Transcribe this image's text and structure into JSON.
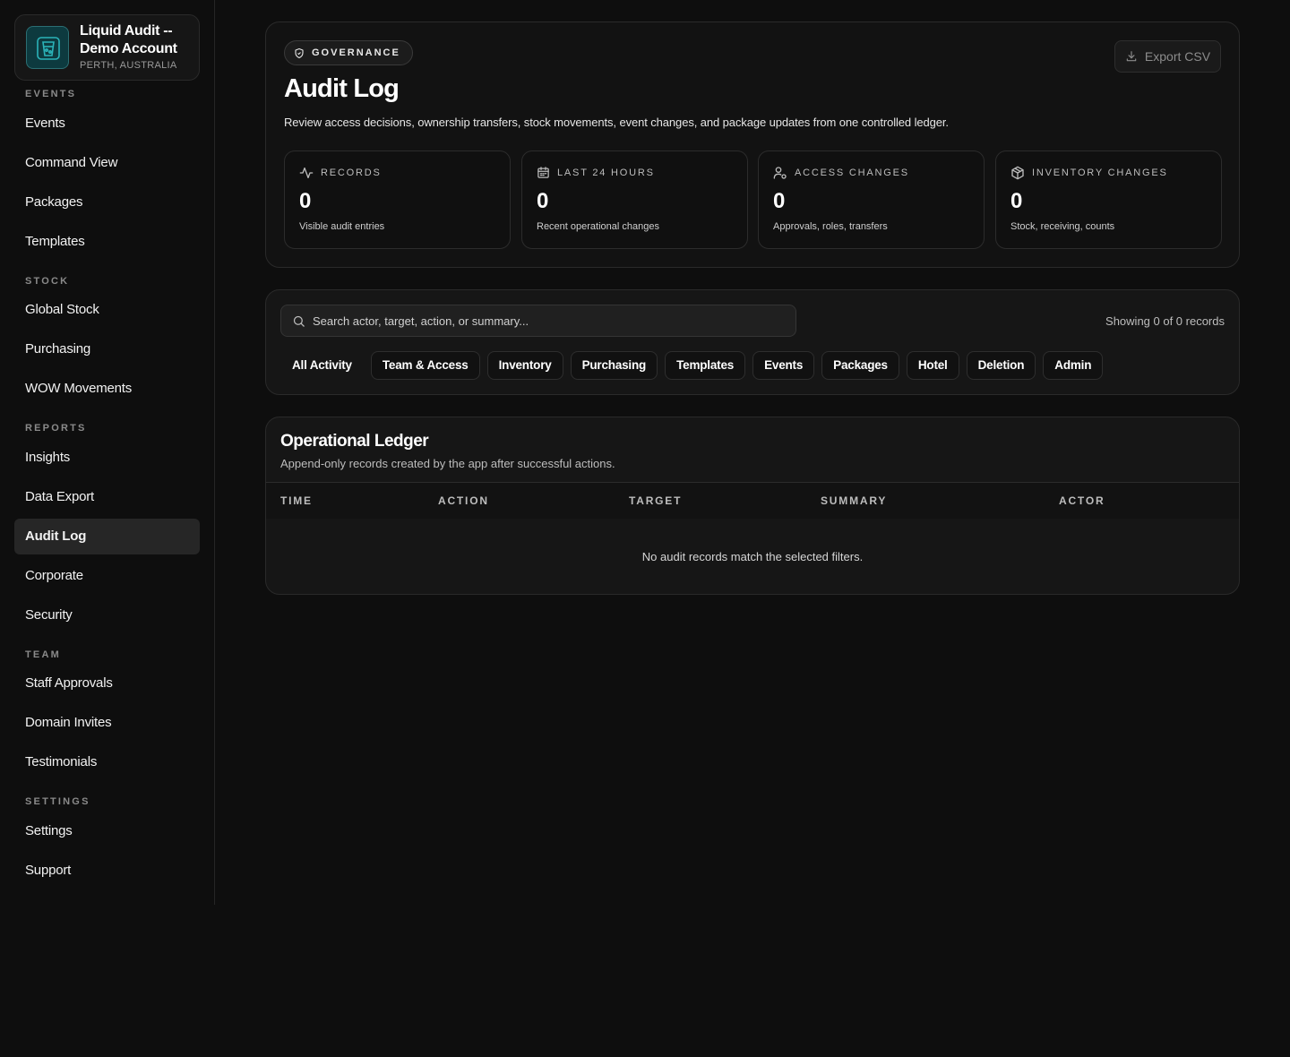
{
  "brand": {
    "name": "Liquid Audit -- Demo Account",
    "location": "PERTH, AUSTRALIA",
    "accent": "#2bb3b8"
  },
  "sidebar": {
    "sections": [
      {
        "label": "EVENTS",
        "items": [
          "Events",
          "Command View",
          "Packages",
          "Templates"
        ]
      },
      {
        "label": "STOCK",
        "items": [
          "Global Stock",
          "Purchasing",
          "WOW Movements"
        ]
      },
      {
        "label": "REPORTS",
        "items": [
          "Insights",
          "Data Export",
          "Audit Log",
          "Corporate",
          "Security"
        ]
      },
      {
        "label": "TEAM",
        "items": [
          "Staff Approvals",
          "Domain Invites",
          "Testimonials"
        ]
      },
      {
        "label": "SETTINGS",
        "items": [
          "Settings",
          "Support"
        ]
      }
    ],
    "active": "Audit Log"
  },
  "hero": {
    "badge": "GOVERNANCE",
    "badge_icon": "shield-icon",
    "title": "Audit Log",
    "description": "Review access decisions, ownership transfers, stock movements, event changes, and package updates from one controlled ledger.",
    "export_label": "Export CSV",
    "export_icon": "download-icon"
  },
  "stats": [
    {
      "label": "RECORDS",
      "icon": "activity-icon",
      "value": "0",
      "sub": "Visible audit entries"
    },
    {
      "label": "LAST 24 HOURS",
      "icon": "calendar-icon",
      "value": "0",
      "sub": "Recent operational changes"
    },
    {
      "label": "ACCESS CHANGES",
      "icon": "user-cog-icon",
      "value": "0",
      "sub": "Approvals, roles, transfers"
    },
    {
      "label": "INVENTORY CHANGES",
      "icon": "package-icon",
      "value": "0",
      "sub": "Stock, receiving, counts"
    }
  ],
  "filters": {
    "search_placeholder": "Search actor, target, action, or summary...",
    "search_value": "",
    "showing": "Showing 0 of 0 records",
    "chips": [
      "All Activity",
      "Team & Access",
      "Inventory",
      "Purchasing",
      "Templates",
      "Events",
      "Packages",
      "Hotel",
      "Deletion",
      "Admin"
    ],
    "active_chip": "All Activity"
  },
  "ledger": {
    "title": "Operational Ledger",
    "subtitle": "Append-only records created by the app after successful actions.",
    "columns": [
      "TIME",
      "ACTION",
      "TARGET",
      "SUMMARY",
      "ACTOR"
    ],
    "empty_message": "No audit records match the selected filters."
  }
}
